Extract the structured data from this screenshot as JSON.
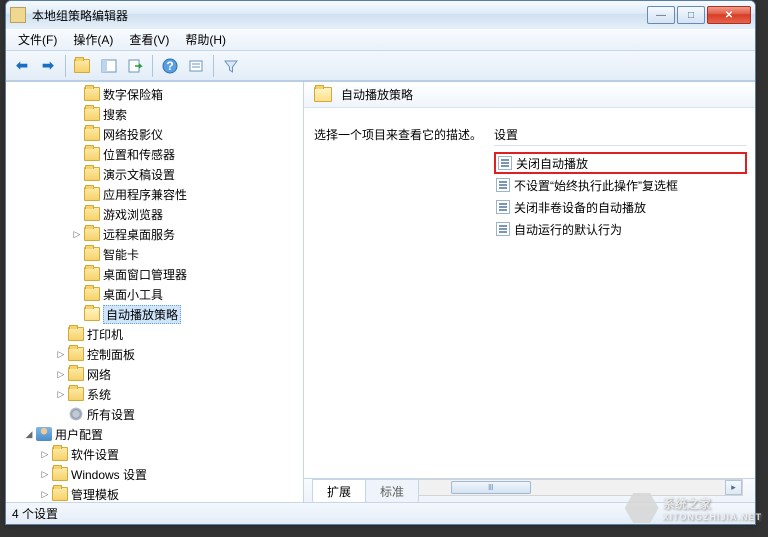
{
  "window": {
    "title": "本地组策略编辑器"
  },
  "menus": {
    "file": "文件(F)",
    "action": "操作(A)",
    "view": "查看(V)",
    "help": "帮助(H)"
  },
  "tree": {
    "items": [
      "数字保险箱",
      "搜索",
      "网络投影仪",
      "位置和传感器",
      "演示文稿设置",
      "应用程序兼容性",
      "游戏浏览器",
      "远程桌面服务",
      "智能卡",
      "桌面窗口管理器",
      "桌面小工具",
      "自动播放策略"
    ],
    "printer": "打印机",
    "controlpanel": "控制面板",
    "network": "网络",
    "system": "系统",
    "allsettings": "所有设置",
    "userconfig": "用户配置",
    "softsettings": "软件设置",
    "winsettings": "Windows 设置",
    "admtemplates": "管理模板"
  },
  "right": {
    "header": "自动播放策略",
    "description": "选择一个项目来查看它的描述。",
    "settings_label": "设置",
    "settings": [
      "关闭自动播放",
      "不设置“始终执行此操作”复选框",
      "关闭非卷设备的自动播放",
      "自动运行的默认行为"
    ]
  },
  "tabs": {
    "extended": "扩展",
    "standard": "标准"
  },
  "status": "4 个设置",
  "watermark": {
    "brand": "系统之家",
    "url": "XITONGZHIJIA.NET"
  }
}
